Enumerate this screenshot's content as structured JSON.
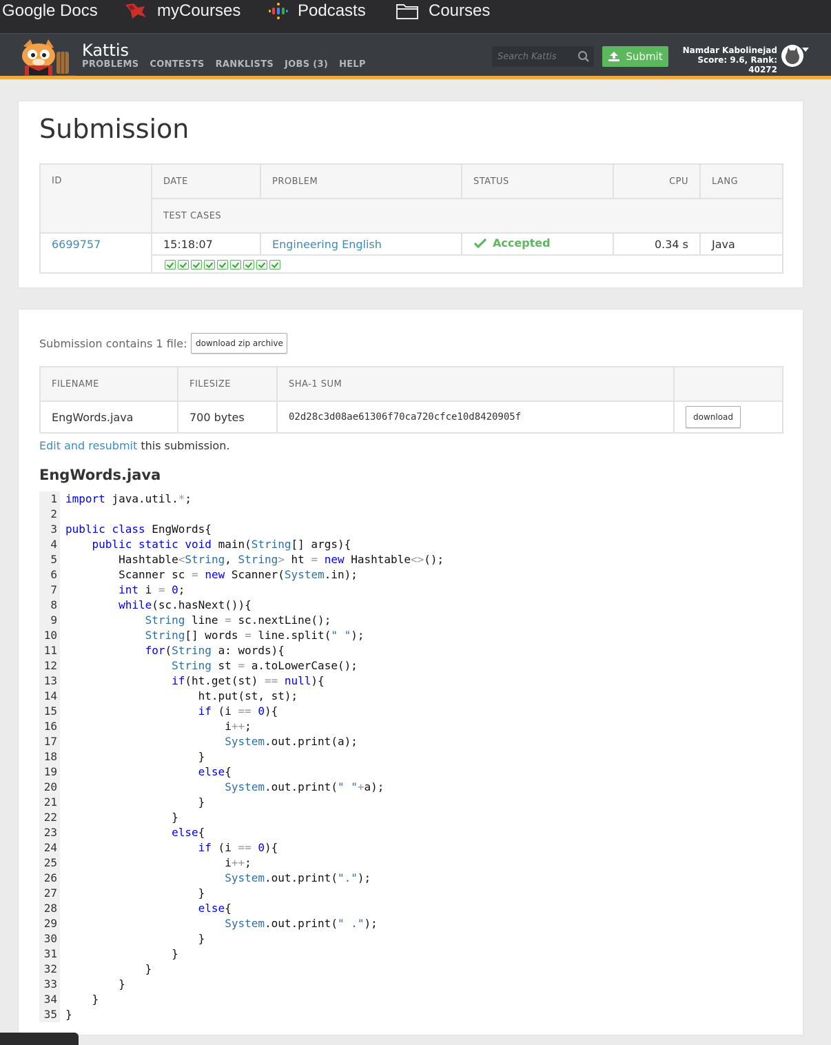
{
  "bookmarks": [
    {
      "label": "Google Docs",
      "icon": "google-docs"
    },
    {
      "label": "myCourses",
      "icon": "mycourses-logo"
    },
    {
      "label": "Podcasts",
      "icon": "podcasts-icon"
    },
    {
      "label": "Courses",
      "icon": "folder-icon"
    }
  ],
  "header": {
    "title": "Kattis",
    "nav": [
      "PROBLEMS",
      "CONTESTS",
      "RANKLISTS",
      "JOBS (3)",
      "HELP"
    ],
    "search_placeholder": "Search Kattis",
    "submit_label": "Submit",
    "user_name": "Namdar Kabolinejad",
    "user_stats": "Score: 9.6, Rank: 40272",
    "accent_color": "#f0a93b"
  },
  "submission": {
    "heading": "Submission",
    "columns": [
      "ID",
      "DATE",
      "PROBLEM",
      "STATUS",
      "CPU",
      "LANG"
    ],
    "test_cases_label": "TEST CASES",
    "id": "6699757",
    "date": "15:18:07",
    "problem": "Engineering English",
    "status": "Accepted",
    "cpu": "0.34 s",
    "lang": "Java",
    "test_cases_passed": 9,
    "status_color": "#5cb85c"
  },
  "files": {
    "intro": "Submission contains 1 file:",
    "zip_button": "download zip archive",
    "columns": [
      "FILENAME",
      "FILESIZE",
      "SHA-1 SUM"
    ],
    "filename": "EngWords.java",
    "filesize": "700 bytes",
    "sha1": "02d28c3d08ae61306f70ca720cfce10d8420905f",
    "download_button": "download",
    "edit_link": "Edit and resubmit",
    "edit_suffix": " this submission."
  },
  "source": {
    "title": "EngWords.java",
    "lines": [
      "import java.util.*;",
      "",
      "public class EngWords{",
      "    public static void main(String[] args){",
      "        Hashtable<String, String> ht = new Hashtable<>();",
      "        Scanner sc = new Scanner(System.in);",
      "        int i = 0;",
      "        while(sc.hasNext()){",
      "            String line = sc.nextLine();",
      "            String[] words = line.split(\" \");",
      "            for(String a: words){",
      "                String st = a.toLowerCase();",
      "                if(ht.get(st) == null){",
      "                    ht.put(st, st);",
      "                    if (i == 0){",
      "                        i++;",
      "                        System.out.print(a);",
      "                    }",
      "                    else{",
      "                        System.out.print(\" \"+a);",
      "                    }",
      "                }",
      "                else{",
      "                    if (i == 0){",
      "                        i++;",
      "                        System.out.print(\".\");",
      "                    }",
      "                    else{",
      "                        System.out.print(\" .\");",
      "                    }",
      "                }",
      "            }",
      "        }",
      "    }",
      "}"
    ]
  }
}
